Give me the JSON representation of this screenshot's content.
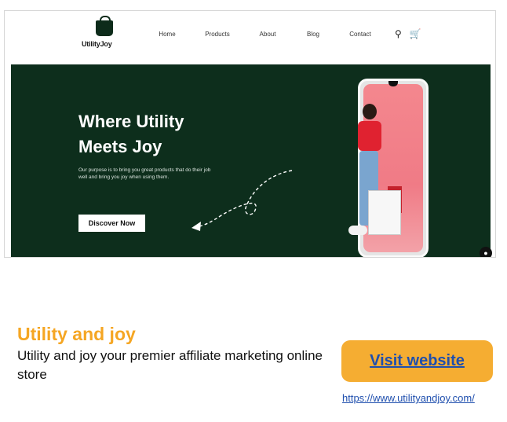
{
  "screenshot": {
    "logo_text": "UtilityJoy",
    "nav": [
      "Home",
      "Products",
      "About",
      "Blog",
      "Contact"
    ],
    "nav_icons": [
      "search-icon",
      "cart-icon"
    ],
    "hero": {
      "title_line1": "Where Utility",
      "title_line2": "Meets  Joy",
      "subtitle": "Our purpose is to bring you great products that do their job well and bring you joy when using them.",
      "cta": "Discover Now",
      "bg_color": "#0d2e1c"
    }
  },
  "card": {
    "title": "Utility and joy",
    "description": "Utility and joy your premier affiliate marketing online store",
    "button_label": "Visit website",
    "url": "https://www.utilityandjoy.com/",
    "accent": "#f5a623",
    "link_color": "#1f4fae"
  }
}
